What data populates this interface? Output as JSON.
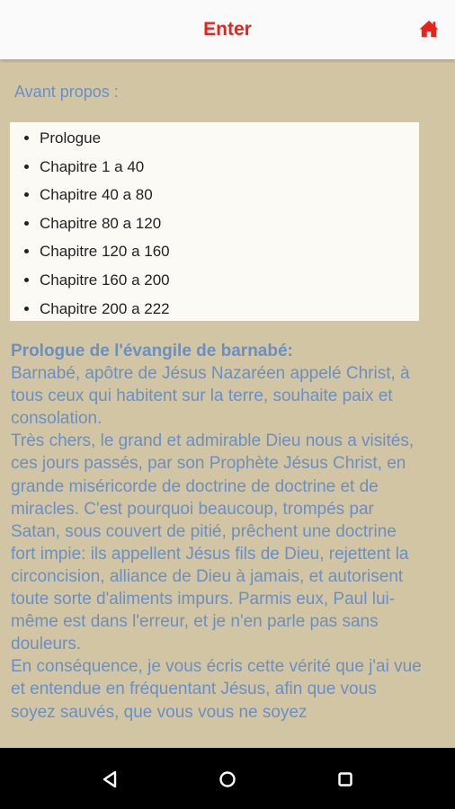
{
  "header": {
    "title": "Enter",
    "home_icon": "home-icon",
    "accent_color": "#e8231b"
  },
  "avant_propos": "Avant propos :",
  "menu_items": [
    "Prologue",
    "Chapitre 1 a 40",
    "Chapitre 40 a 80",
    "Chapitre 80 a 120",
    "Chapitre 120 a 160",
    "Chapitre 160 a 200",
    "Chapitre 200 a 222"
  ],
  "prologue": {
    "heading": "Prologue de l'évangile de barnabé:",
    "paragraphs": [
      "Barnabé, apôtre de Jésus Nazaréen appelé Christ, à tous ceux qui habitent sur la terre, souhaite paix et consolation.",
      "Très chers, le grand et admirable Dieu nous a visités, ces jours passés, par son Prophète Jésus Christ, en grande miséricorde de doctrine de doctrine et de miracles. C'est pourquoi beaucoup, trompés par Satan, sous couvert de pitié, prêchent une doctrine fort impie: ils appellent Jésus fils de Dieu, rejettent la circoncision, alliance de Dieu à jamais, et autorisent toute sorte d'aliments impurs. Parmis eux, Paul lui-même est dans l'erreur, et je n'en parle pas sans douleurs.",
      "En conséquence, je vous écris cette vérité que j'ai vue et entendue en fréquentant Jésus, afin que vous soyez sauvés, que vous vous ne soyez"
    ]
  },
  "text_color": "#6b8fc3",
  "background_color": "#d1c5a4",
  "navigation": {
    "back_icon": "back-triangle-icon",
    "home_icon": "home-circle-icon",
    "recents_icon": "recents-square-icon"
  }
}
